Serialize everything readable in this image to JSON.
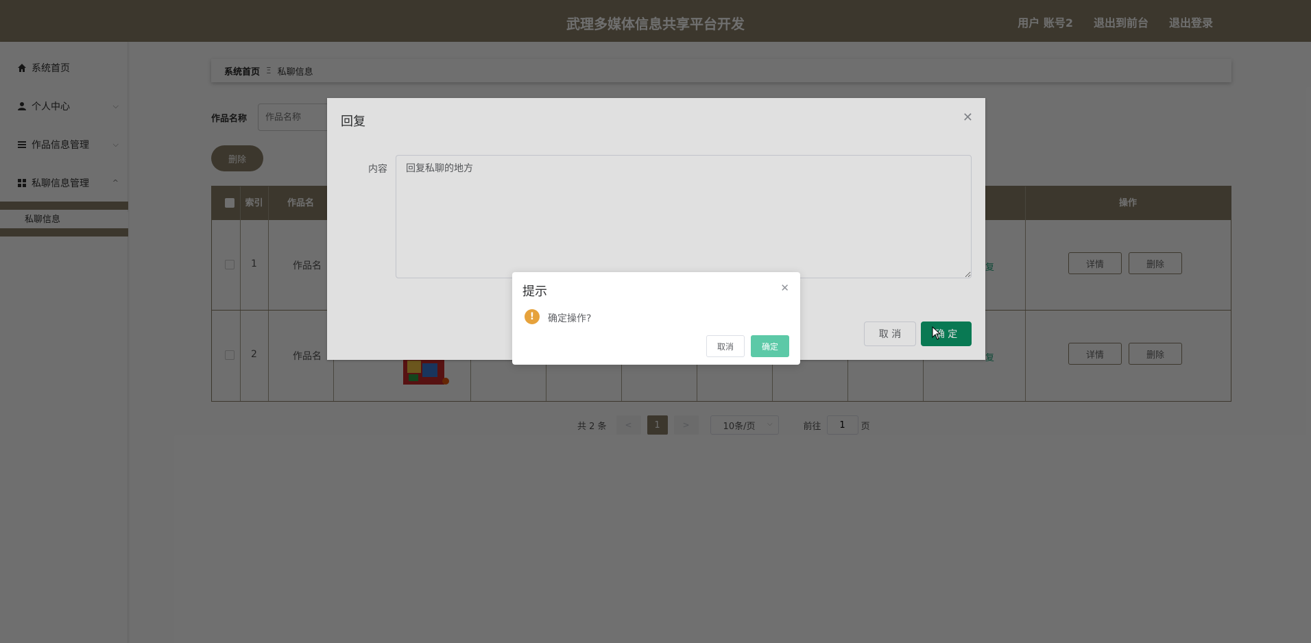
{
  "header": {
    "title": "武理多媒体信息共享平台开发",
    "user": "用户 账号2",
    "to_front": "退出到前台",
    "logout": "退出登录"
  },
  "sidebar": {
    "items": [
      {
        "label": "系统首页",
        "icon": "home-icon"
      },
      {
        "label": "个人中心",
        "icon": "user-icon"
      },
      {
        "label": "作品信息管理",
        "icon": "list-icon"
      },
      {
        "label": "私聊信息管理",
        "icon": "grid-icon"
      }
    ],
    "submenu_item": "私聊信息"
  },
  "breadcrumb": {
    "home": "系统首页",
    "separator": "Ξ",
    "current": "私聊信息"
  },
  "search": {
    "label": "作品名称",
    "placeholder": "作品名称"
  },
  "toolbar": {
    "delete_label": "删除"
  },
  "table": {
    "headers": [
      "索引",
      "作品名",
      "复",
      "操作"
    ],
    "rows": [
      {
        "index": "1",
        "name": "作品名",
        "reply": "复",
        "detail": "详情",
        "delete": "删除"
      },
      {
        "index": "2",
        "name": "作品名",
        "reply": "复",
        "detail": "详情",
        "delete": "删除"
      }
    ]
  },
  "pagination": {
    "total": "共 2 条",
    "prev": "<",
    "current": "1",
    "next": ">",
    "page_size": "10条/页",
    "goto_label": "前往",
    "goto_value": "1",
    "goto_suffix": "页"
  },
  "reply_dialog": {
    "title": "回复",
    "content_label": "内容",
    "content_value": "回复私聊的地方",
    "cancel": "取 消",
    "ok": "确 定"
  },
  "confirm_dialog": {
    "title": "提示",
    "icon": "!",
    "message": "确定操作?",
    "cancel": "取消",
    "ok": "确定"
  },
  "colors": {
    "brand": "#8a7f68",
    "reply_ok": "#0b8a5f",
    "confirm_ok": "#5cc9a7",
    "warning": "#e6a23c"
  }
}
